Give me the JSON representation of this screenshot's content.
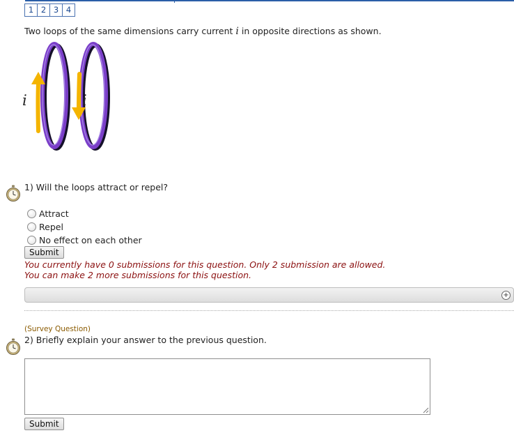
{
  "pager": {
    "pages": [
      "1",
      "2",
      "3",
      "4"
    ]
  },
  "intro": {
    "text_before": "Two loops of the same dimensions carry current ",
    "variable": "i",
    "text_after": " in opposite directions as shown."
  },
  "figure": {
    "left_current_label": "i",
    "right_current_label": "i",
    "loop_color": "#7b3fc9",
    "arrow_color": "#f4b400"
  },
  "question1": {
    "text": "1) Will the loops attract or repel?",
    "options": [
      "Attract",
      "Repel",
      "No effect on each other"
    ],
    "submit_label": "Submit",
    "note_line1": "You currently have 0 submissions for this question. Only 2 submission are allowed.",
    "note_line2": "You can make 2 more submissions for this question."
  },
  "question2": {
    "tag": "(Survey Question)",
    "text": "2) Briefly explain your answer to the previous question.",
    "answer_value": "",
    "submit_label": "Submit"
  },
  "colors": {
    "link": "#1d4a91",
    "note": "#8b1010",
    "survey_tag": "#8a5a00"
  }
}
